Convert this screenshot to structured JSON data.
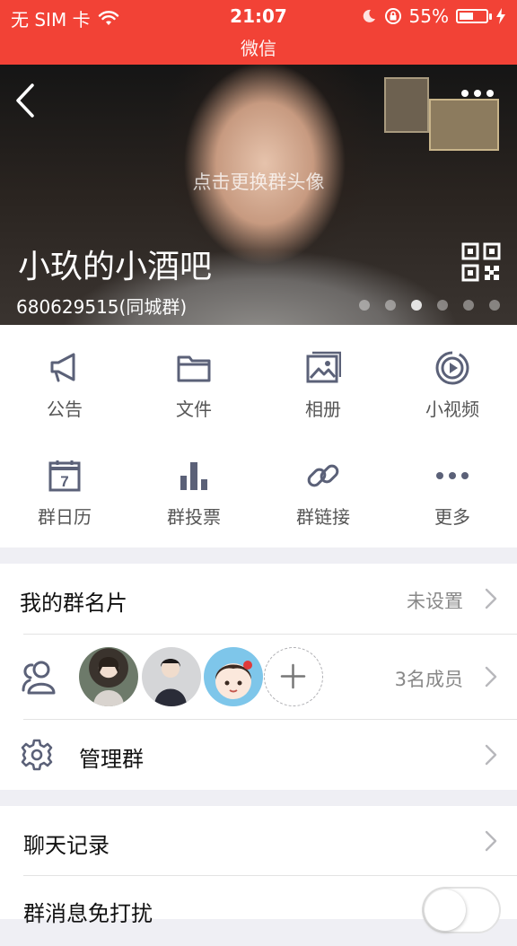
{
  "status_bar": {
    "carrier": "无 SIM 卡",
    "time": "21:07",
    "battery": "55%",
    "battery_level": 0.55,
    "subtitle": "微信"
  },
  "header": {
    "change_avatar_hint": "点击更换群头像",
    "group_name": "小玖的小酒吧",
    "group_id": "680629515(同城群)",
    "page_dots": 6,
    "active_dot": 3
  },
  "grid": {
    "items": [
      {
        "label": "公告",
        "icon": "megaphone-icon"
      },
      {
        "label": "文件",
        "icon": "folder-icon"
      },
      {
        "label": "相册",
        "icon": "photo-album-icon"
      },
      {
        "label": "小视频",
        "icon": "video-icon"
      },
      {
        "label": "群日历",
        "icon": "calendar-icon",
        "calendar_day": "7"
      },
      {
        "label": "群投票",
        "icon": "bar-chart-icon"
      },
      {
        "label": "群链接",
        "icon": "link-icon"
      },
      {
        "label": "更多",
        "icon": "more-dots-icon"
      }
    ]
  },
  "settings": {
    "group_card": {
      "label": "我的群名片",
      "value": "未设置"
    },
    "members": {
      "count_label": "3名成员"
    },
    "manage": {
      "label": "管理群"
    }
  },
  "chat": {
    "history_label": "聊天记录",
    "mute_label": "群消息免打扰",
    "mute_on": false
  },
  "colors": {
    "status_red": "#f24236",
    "icon_slate": "#5b6178",
    "text_gray": "#888888"
  }
}
